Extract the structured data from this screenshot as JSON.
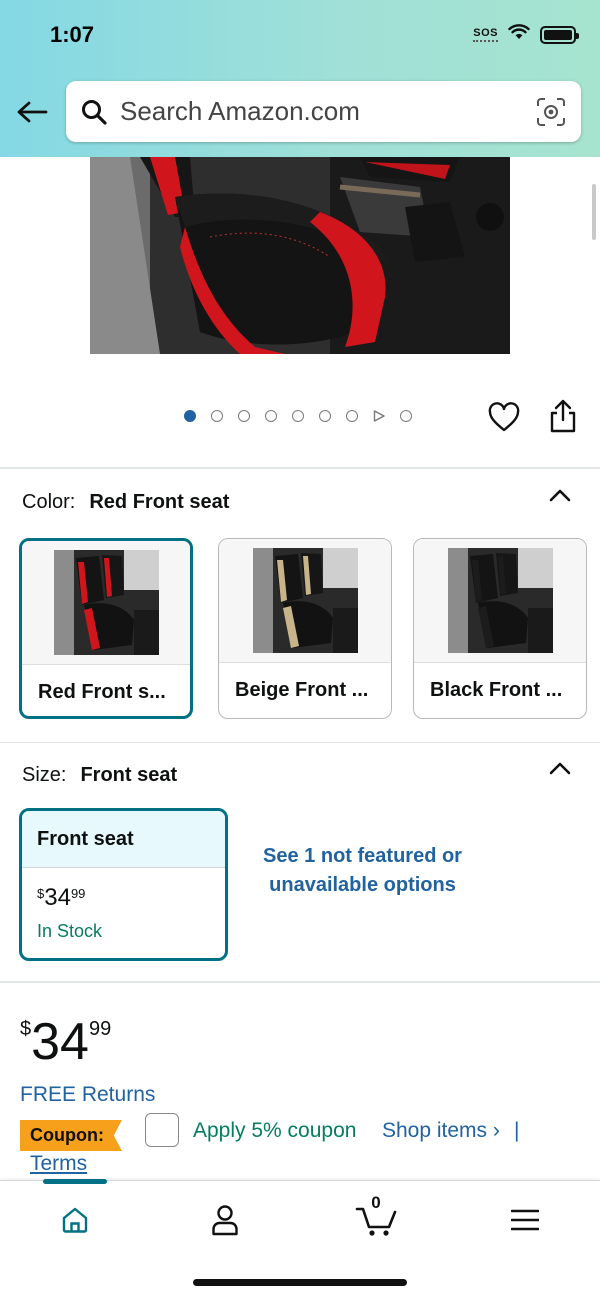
{
  "status_bar": {
    "time": "1:07",
    "sos": "SOS"
  },
  "search": {
    "placeholder": "Search Amazon.com"
  },
  "color_section": {
    "label": "Color:",
    "selected": "Red Front seat",
    "options": [
      {
        "name": "Red Front s...",
        "accent": "#d0161c",
        "selected": true
      },
      {
        "name": "Beige Front ...",
        "accent": "#c8b48a",
        "selected": false
      },
      {
        "name": "Black Front ...",
        "accent": "#1c1c1c",
        "selected": false
      }
    ]
  },
  "size_section": {
    "label": "Size:",
    "selected": "Front seat",
    "option": {
      "name": "Front seat",
      "currency": "$",
      "whole": "34",
      "fraction": "99",
      "stock": "In Stock"
    },
    "see_more": "See 1 not featured or unavailable options"
  },
  "price": {
    "currency": "$",
    "whole": "34",
    "fraction": "99"
  },
  "free_returns": "FREE Returns",
  "coupon": {
    "badge": "Coupon:",
    "apply_text": "Apply 5% coupon",
    "shop_items": "Shop items ›",
    "separator": "|",
    "terms": "Terms"
  },
  "image_carousel": {
    "total_images": 9,
    "active_index": 0,
    "video_index": 7
  },
  "bottom_nav": {
    "cart_count": "0"
  },
  "colors": {
    "accent_teal": "#007185",
    "link_blue": "#2162a1",
    "stock_green": "#067d62",
    "coupon_orange": "#f7a01c"
  }
}
